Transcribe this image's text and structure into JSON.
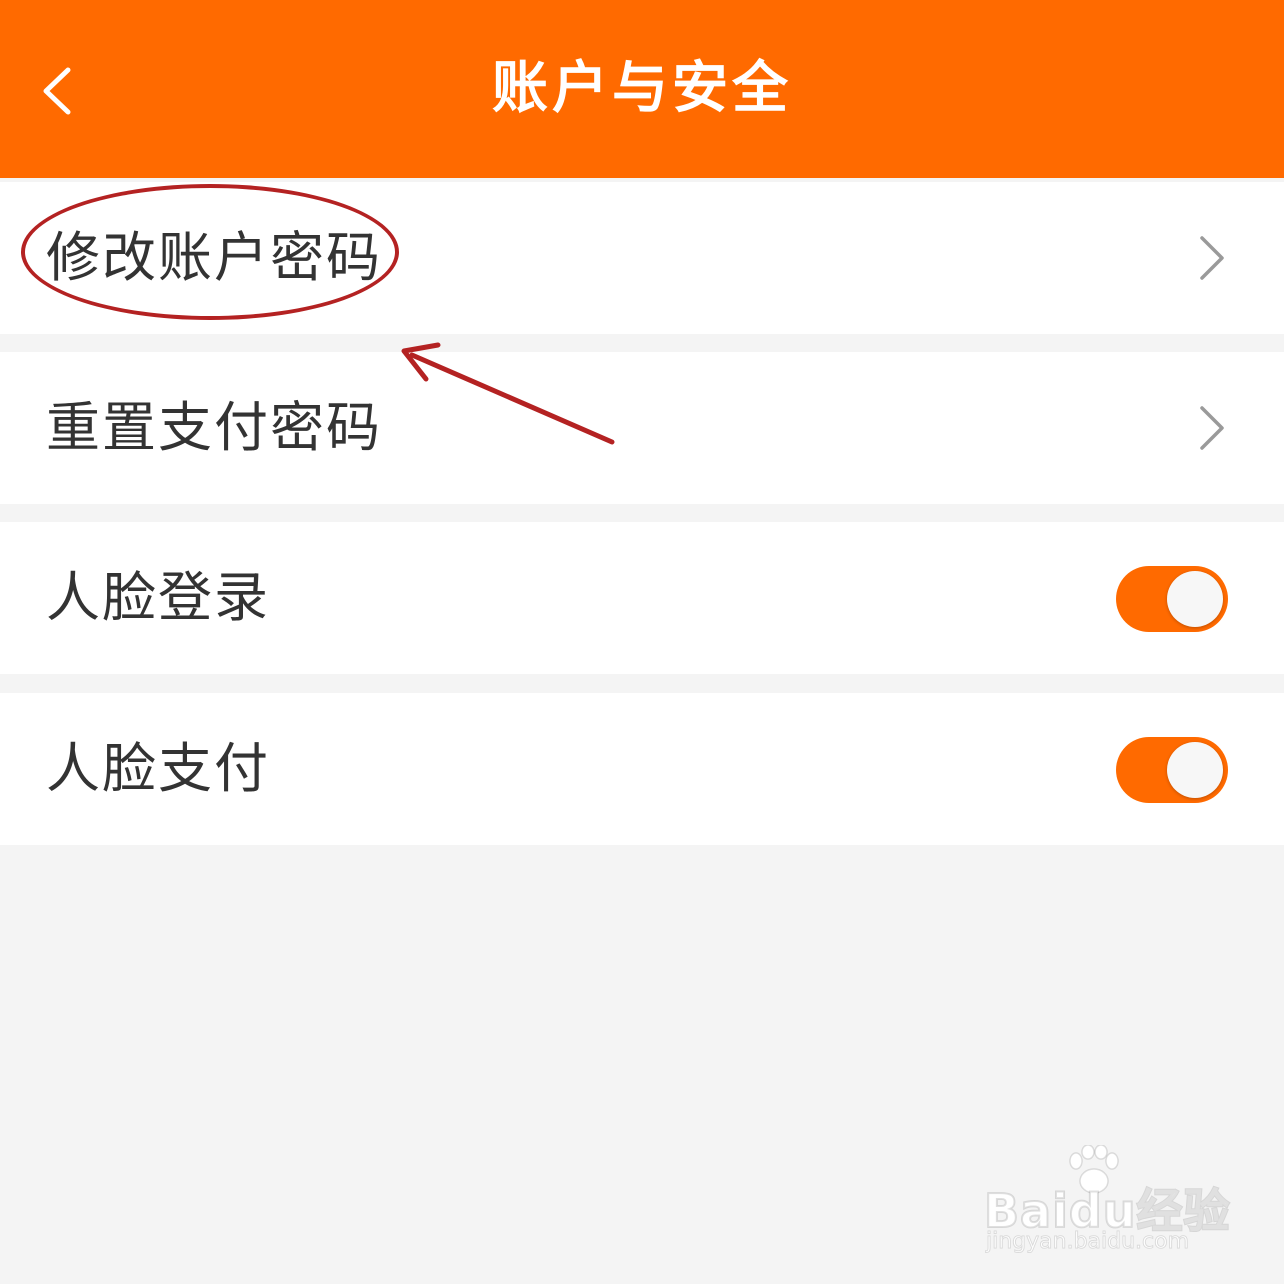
{
  "header": {
    "title": "账户与安全",
    "background": "#ff6a00",
    "back_icon": "chevron-left-icon"
  },
  "rows": [
    {
      "label": "修改账户密码",
      "control": "chevron-right-icon",
      "highlighted": true
    },
    {
      "label": "重置支付密码",
      "control": "chevron-right-icon"
    },
    {
      "label": "人脸登录",
      "control": "toggle",
      "on": true
    },
    {
      "label": "人脸支付",
      "control": "toggle",
      "on": true
    }
  ],
  "annotation": {
    "color": "#b42222",
    "shapes": [
      "ellipse",
      "arrow"
    ]
  },
  "watermark": {
    "brand": "Baidu经验",
    "url": "jingyan.baidu.com"
  },
  "colors": {
    "accent": "#ff6a00",
    "page_background": "#f4f4f4",
    "row_background": "#ffffff",
    "text": "#333333"
  }
}
